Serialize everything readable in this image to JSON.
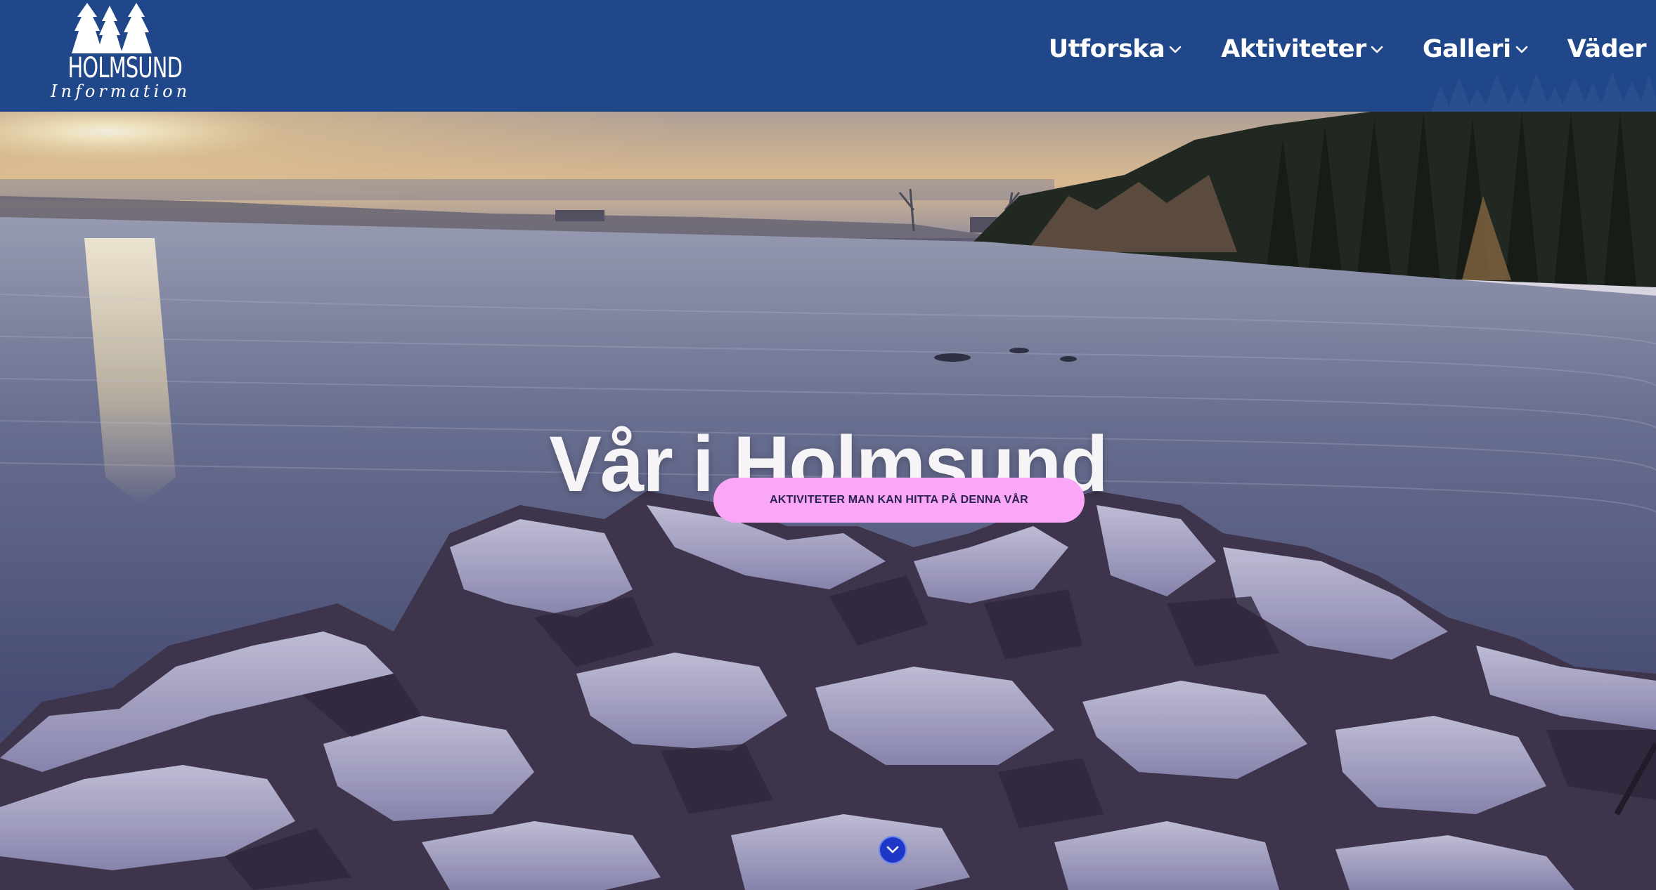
{
  "header": {
    "logo": {
      "title": "HOLMSUND",
      "subtitle": "Information",
      "icon": "pine-trees-icon"
    },
    "nav": [
      {
        "label": "Utforska",
        "has_dropdown": true
      },
      {
        "label": "Aktiviteter",
        "has_dropdown": true
      },
      {
        "label": "Galleri",
        "has_dropdown": true
      },
      {
        "label": "Väder",
        "has_dropdown": false
      }
    ]
  },
  "hero": {
    "title": "Vår i Holmsund",
    "cta_label": "AKTIVITETER MAN KAN HITTA PÅ DENNA VÅR",
    "scroll_icon": "chevron-down-icon"
  },
  "colors": {
    "header_bg": "#1f4789",
    "cta_bg": "#f9a7f6",
    "cta_text": "#2a2350",
    "scroll_button": "#1e37c7"
  }
}
